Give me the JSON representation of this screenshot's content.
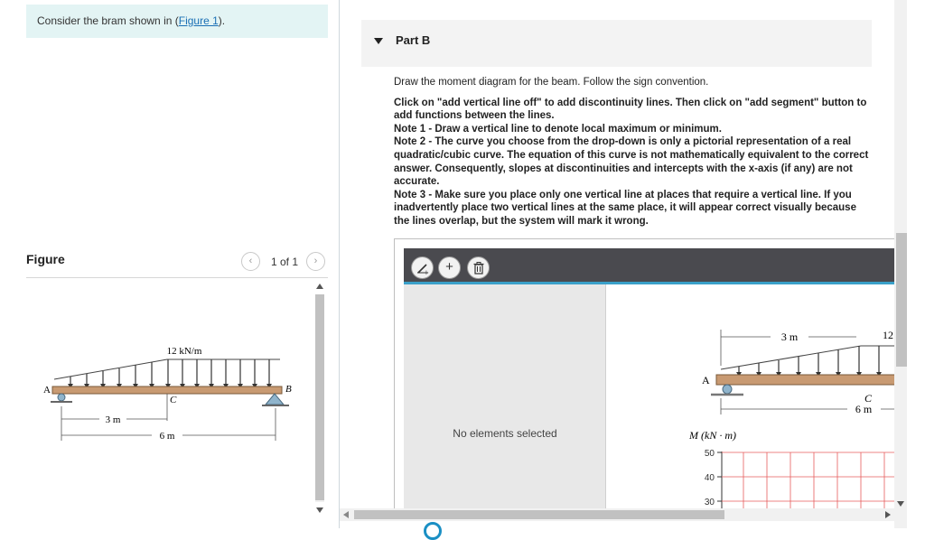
{
  "prompt": {
    "text_before": "Consider the bram shown in (",
    "link": "Figure 1",
    "text_after": ")."
  },
  "figure_panel": {
    "title": "Figure",
    "pager": "1 of 1",
    "prev_icon": "‹",
    "next_icon": "›"
  },
  "beam_figure": {
    "load_label": "12 kN/m",
    "support_a": "A",
    "support_b": "B",
    "point_c": "C",
    "dim_short": "3 m",
    "dim_long": "6 m"
  },
  "part": {
    "label": "Part B",
    "intro": "Draw the moment diagram for the beam. Follow the sign convention.",
    "click_note": "Click on \"add vertical line off\" to add discontinuity lines. Then click on \"add segment\" button to add functions between the lines.",
    "note1": "Note 1 - Draw a vertical line to denote local maximum or minimum.",
    "note2": "Note 2 - The curve you choose from the drop-down is only a pictorial representation of a real quadratic/cubic curve. The equation of this curve is not mathematically equivalent to the correct answer. Consequently, slopes at discontinuities and intercepts with the x-axis (if any) are not accurate.",
    "note3": "Note 3 - Make sure you place only one vertical line at places that require a vertical line. If you inadvertently place two vertical lines at the same place, it will appear correct visually because the lines overlap, but the system will mark it wrong."
  },
  "tool": {
    "add_line_icon": "add-vertical-line-icon",
    "add_segment_icon": "plus-icon",
    "delete_icon": "trash-icon",
    "empty_message": "No elements selected",
    "canvas_dim_top": "3 m",
    "canvas_load_partial": "12",
    "canvas_support_a": "A",
    "canvas_point_c": "C",
    "canvas_dim_long": "6 m",
    "axis_label": "M (kN · m)",
    "ticks": [
      "50",
      "40",
      "30"
    ]
  },
  "colors": {
    "prompt_bg": "#e3f4f4",
    "link": "#1a6fb5",
    "toolbar": "#4a4a4f",
    "accent": "#3aa0c9",
    "grid": "#e65c5c"
  }
}
